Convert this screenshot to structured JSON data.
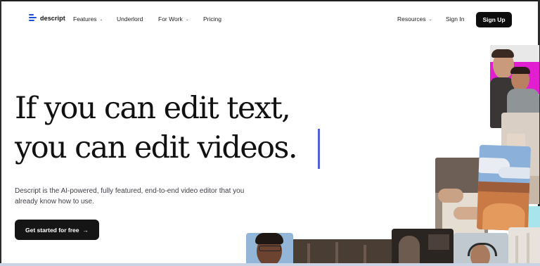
{
  "brand": {
    "name": "descript"
  },
  "nav": {
    "left": [
      {
        "label": "Features",
        "dropdown": true
      },
      {
        "label": "Underlord",
        "dropdown": false
      },
      {
        "label": "For Work",
        "dropdown": true
      },
      {
        "label": "Pricing",
        "dropdown": false
      }
    ],
    "resources": "Resources",
    "sign_in": "Sign In",
    "sign_up": "Sign Up"
  },
  "hero": {
    "headline_line1": "If you can edit text,",
    "headline_line2": "you can edit videos.",
    "subtext": "Descript is the AI-powered, fully featured, end-to-end video editor that you already know how to use.",
    "cta": "Get started for free",
    "cta_arrow": "→"
  },
  "colors": {
    "accent": "#1d4ed8",
    "cursor": "#5560d8",
    "button_bg": "#0d0d0d",
    "magenta": "#e11fd0"
  }
}
